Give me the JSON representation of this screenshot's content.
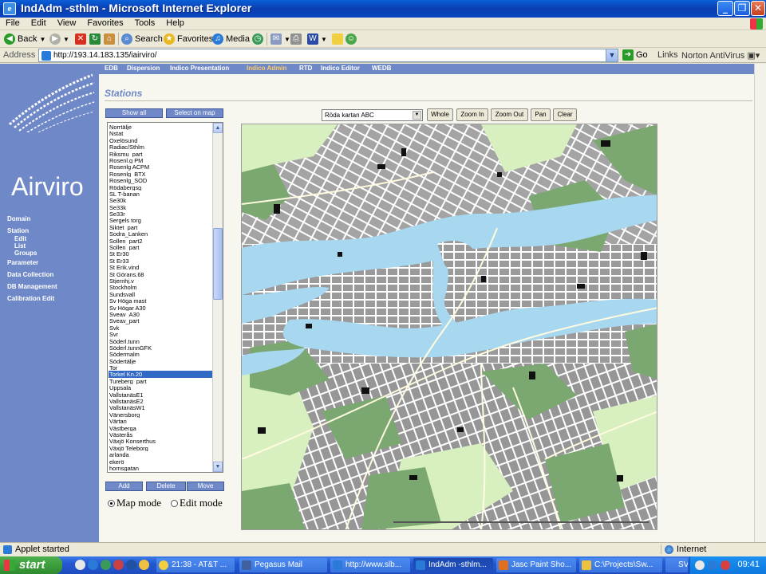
{
  "window": {
    "title": "IndAdm -sthlm - Microsoft Internet Explorer"
  },
  "menu": [
    "File",
    "Edit",
    "View",
    "Favorites",
    "Tools",
    "Help"
  ],
  "toolbar": {
    "back": "Back",
    "search": "Search",
    "favorites": "Favorites",
    "media": "Media"
  },
  "address": {
    "label": "Address",
    "url": "http://193.14.183.135/iairviro/",
    "go": "Go",
    "links": "Links",
    "norton": "Norton AntiVirus"
  },
  "left": {
    "logo": "Airviro",
    "nav": {
      "domain": "Domain",
      "station": "Station",
      "edit": "Edit",
      "list": "List",
      "groups": "Groups",
      "parameter": "Parameter",
      "data_collection": "Data Collection",
      "db_management": "DB Management",
      "calibration_edit": "Calibration Edit"
    }
  },
  "topnav": [
    "EDB",
    "Dispersion",
    "Indico Presentation",
    "Indico Admin",
    "RTD",
    "Indico Editor",
    "WEDB"
  ],
  "topnav_active": "Indico Admin",
  "page": {
    "heading": "Stations",
    "show_all": "Show all",
    "select_on_map": "Select on map",
    "add": "Add",
    "delete": "Delete",
    "move": "Move",
    "map_mode": "Map mode",
    "edit_mode": "Edit mode",
    "selected_station": "Torkel Kn.20",
    "mode_selected": "Map mode"
  },
  "stations": [
    "Norrtälje",
    "Nstat",
    "Oxelösund",
    "Radiac/Sthlm",
    "Riksmu_part",
    "Rosenl.g PM",
    "Rosenlg ACPM",
    "Rosenlg_BTX",
    "Rosenlg_SOD",
    "Rödabergsg",
    "SL T-banan",
    "Se30k",
    "Se33k",
    "Se33r",
    "Sergels torg",
    "Siktet_part",
    "Sodra_Lanken",
    "Sollen_part2",
    "Sollen_part",
    "St Er30",
    "St Er33",
    "St Erik.vind",
    "St Görans.68",
    "Stjernhj.v",
    "Stockholm",
    "Sundsvall",
    "Sv Höga mast",
    "Sv Högar A30",
    "Sveav_A30",
    "Sveav_part",
    "Svk",
    "Svr",
    "Söderl.tunn",
    "Söderl.tunnGFK",
    "Södermalm",
    "Södertälje",
    "Tor",
    "Torkel Kn.20",
    "Tureberg_part",
    "Uppsala",
    "VallstanäsE1",
    "VallstanäsE2",
    "VallstanäsW1",
    "Vänersborg",
    "Värtan",
    "Västberga",
    "Västerås",
    "Växjö Konserthus",
    "Växjö Teleborg",
    "arlanda",
    "ekerö",
    "hornsgatan"
  ],
  "map": {
    "layer_select": "Röda kartan ABC",
    "buttons": {
      "whole": "Whole",
      "zoom_in": "Zoom In",
      "zoom_out": "Zoom Out",
      "pan": "Pan",
      "clear": "Clear"
    }
  },
  "status": {
    "text": "Applet started",
    "zone": "Internet"
  },
  "taskbar": {
    "start": "start",
    "tasks": [
      "21:38 - AT&T ...",
      "Pegasus Mail",
      "http://www.slb...",
      "IndAdm -sthlm...",
      "Jasc Paint Sho...",
      "C:\\Projects\\Sw...",
      "SV"
    ],
    "clock": "09:41"
  },
  "colors": {
    "panel_blue": "#6f88c8",
    "water": "#a8d8f0",
    "green": "#7aa870",
    "lightgreen": "#d8f0c0",
    "accent_nav": "#ffcc66"
  }
}
